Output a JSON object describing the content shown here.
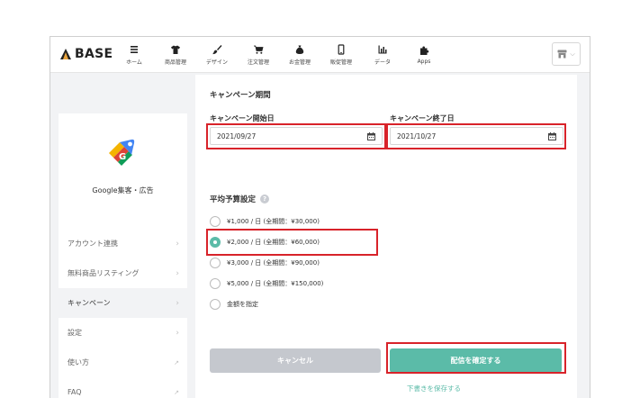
{
  "brand": {
    "logo_text": "BASE"
  },
  "nav": [
    {
      "label": "ホーム",
      "icon": "list-icon"
    },
    {
      "label": "商品管理",
      "icon": "shirt-icon"
    },
    {
      "label": "デザイン",
      "icon": "brush-icon"
    },
    {
      "label": "注文管理",
      "icon": "cart-icon"
    },
    {
      "label": "お金管理",
      "icon": "money-bag-icon"
    },
    {
      "label": "販促管理",
      "icon": "phone-icon"
    },
    {
      "label": "データ",
      "icon": "bar-chart-icon"
    },
    {
      "label": "Apps",
      "icon": "puzzle-icon"
    }
  ],
  "sidebar": {
    "app_name": "Google集客・広告",
    "items": [
      {
        "label": "アカウント連携",
        "marker": "›"
      },
      {
        "label": "無料商品リスティング",
        "marker": "›"
      },
      {
        "label": "キャンペーン",
        "marker": "›"
      },
      {
        "label": "設定",
        "marker": "›"
      },
      {
        "label": "使い方",
        "marker": "↗"
      },
      {
        "label": "FAQ",
        "marker": "↗"
      }
    ]
  },
  "form": {
    "period_title": "キャンペーン期間",
    "start_label": "キャンペーン開始日",
    "start_value": "2021/09/27",
    "end_label": "キャンペーン終了日",
    "end_value": "2021/10/27",
    "budget_title": "平均予算設定",
    "help_mark": "?",
    "options": [
      "¥1,000 / 日 (全期間：¥30,000)",
      "¥2,000 / 日 (全期間：¥60,000)",
      "¥3,000 / 日 (全期間：¥90,000)",
      "¥5,000 / 日 (全期間：¥150,000)",
      "金額を指定"
    ],
    "selected_index": 1,
    "cancel_label": "キャンセル",
    "confirm_label": "配信を確定する",
    "save_draft_label": "下書きを保存する"
  },
  "colors": {
    "accent": "#5bbba8",
    "highlight": "#d8232a",
    "cancel": "#c5c8ce"
  }
}
